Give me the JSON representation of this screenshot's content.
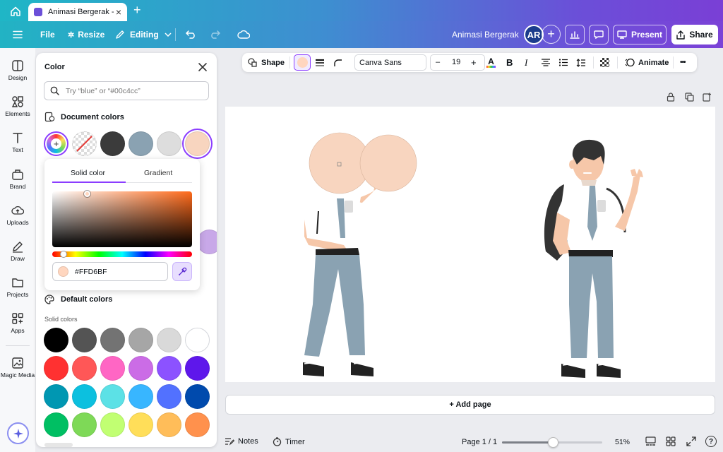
{
  "browser": {
    "home_icon": "home-icon",
    "tab_title": "Animasi Bergerak - ...",
    "tab_close": "×",
    "new_tab": "+"
  },
  "toolbar": {
    "menu_icon": "hamburger-icon",
    "file": "File",
    "resize": "Resize",
    "editing": "Editing",
    "project_title": "Animasi Bergerak",
    "avatar_initials": "AR",
    "present": "Present",
    "share": "Share",
    "accent": "#8b3dff"
  },
  "rail": {
    "items": [
      {
        "label": "Design",
        "icon": "design-icon"
      },
      {
        "label": "Elements",
        "icon": "elements-icon"
      },
      {
        "label": "Text",
        "icon": "text-icon"
      },
      {
        "label": "Brand",
        "icon": "brand-icon"
      },
      {
        "label": "Uploads",
        "icon": "uploads-icon"
      },
      {
        "label": "Draw",
        "icon": "draw-icon"
      },
      {
        "label": "Projects",
        "icon": "projects-icon"
      },
      {
        "label": "Apps",
        "icon": "apps-icon"
      },
      {
        "label": "Magic Media",
        "icon": "magic-media-icon"
      }
    ]
  },
  "color_panel": {
    "title": "Color",
    "search_placeholder": "Try “blue” or “#00c4cc”",
    "document_colors_label": "Document colors",
    "document_colors": [
      "#3b3b3b",
      "#8aa2b2",
      "#dddddd",
      "#f8d5bf"
    ],
    "default_colors_label": "Default colors",
    "solid_colors_label": "Solid colors",
    "solid_colors": [
      [
        "#000000",
        "#545454",
        "#737373",
        "#a6a6a6",
        "#d9d9d9",
        "#ffffff"
      ],
      [
        "#ff3131",
        "#ff5757",
        "#ff66c4",
        "#cb6ce6",
        "#8c52ff",
        "#5e17eb"
      ],
      [
        "#0097b2",
        "#0cc0df",
        "#5ce1e6",
        "#38b6ff",
        "#5271ff",
        "#004aad"
      ],
      [
        "#00bf63",
        "#7ed957",
        "#c1ff72",
        "#ffde59",
        "#ffbd59",
        "#ff914d"
      ]
    ]
  },
  "picker": {
    "tab_solid": "Solid color",
    "tab_gradient": "Gradient",
    "hex_value": "#FFD6BF",
    "selected_color": "#ffd6bf"
  },
  "context_toolbar": {
    "shape": "Shape",
    "font": "Canva Sans",
    "font_size": "19",
    "minus": "–",
    "plus": "+",
    "bold": "B",
    "italic": "I",
    "animate": "Animate",
    "more": "•••"
  },
  "bottom": {
    "add_page": "+ Add page",
    "notes": "Notes",
    "timer": "Timer",
    "page_indicator": "Page 1 / 1",
    "zoom": "51%",
    "zoom_level": 0.51,
    "help": "?"
  }
}
